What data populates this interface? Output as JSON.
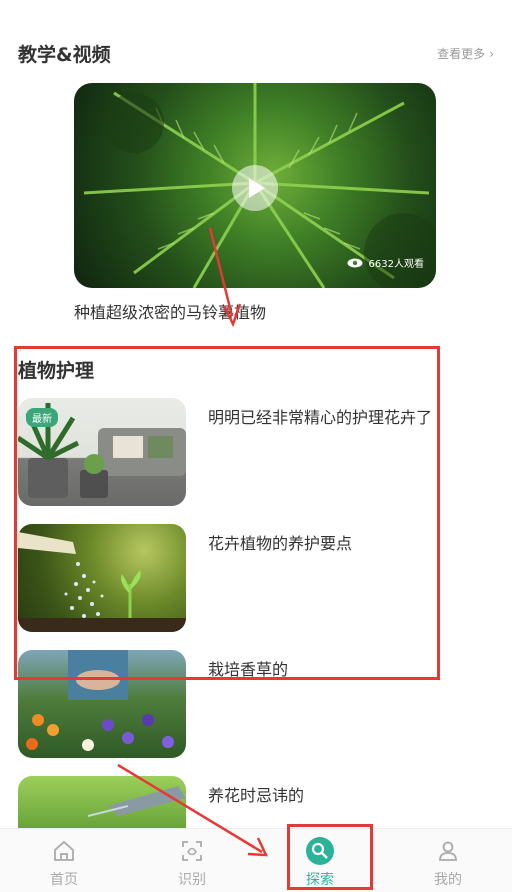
{
  "section": {
    "title": "教学&视频",
    "see_more": "查看更多",
    "see_more_chevron": "›"
  },
  "video": {
    "title": "种植超级浓密的马铃薯植物",
    "views": "6632人观看"
  },
  "care": {
    "title": "植物护理",
    "badge": "最新",
    "articles": [
      {
        "title": "明明已经非常精心的护理花卉了"
      },
      {
        "title": "花卉植物的养护要点"
      },
      {
        "title": "栽培香草的"
      },
      {
        "title": "养花时忌讳的"
      }
    ]
  },
  "tabbar": {
    "items": [
      {
        "label": "首页",
        "icon": "home-icon"
      },
      {
        "label": "识别",
        "icon": "scan-icon"
      },
      {
        "label": "探索",
        "icon": "explore-icon"
      },
      {
        "label": "我的",
        "icon": "user-icon"
      }
    ],
    "active_color": "#2bb39a"
  },
  "annotation_color": "#e53935"
}
